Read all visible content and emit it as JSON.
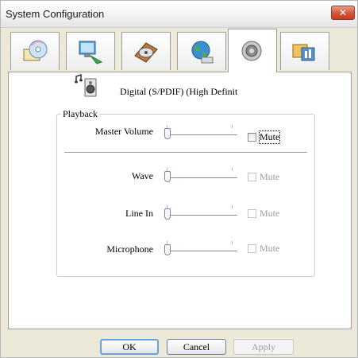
{
  "window": {
    "title": "System Configuration",
    "close_icon": "close-icon"
  },
  "tabs": [
    {
      "icon": "cd-icon",
      "selected": false
    },
    {
      "icon": "monitor-speaker-icon",
      "selected": false
    },
    {
      "icon": "hard-disk-icon",
      "selected": false
    },
    {
      "icon": "globe-icon",
      "selected": false
    },
    {
      "icon": "speaker-icon",
      "selected": true
    },
    {
      "icon": "tools-icon",
      "selected": false
    }
  ],
  "device": {
    "icon": "audio-device-icon",
    "name": "Digital (S/PDIF) (High Definit"
  },
  "playback": {
    "group_label": "Playback",
    "controls": [
      {
        "label": "Master Volume",
        "mute_label": "Mute",
        "mute_checked": false,
        "mute_enabled": true,
        "level": 0
      },
      {
        "label": "Wave",
        "mute_label": "Mute",
        "mute_checked": false,
        "mute_enabled": false,
        "level": 0
      },
      {
        "label": "Line In",
        "mute_label": "Mute",
        "mute_checked": false,
        "mute_enabled": false,
        "level": 0
      },
      {
        "label": "Microphone",
        "mute_label": "Mute",
        "mute_checked": false,
        "mute_enabled": false,
        "level": 0
      }
    ]
  },
  "buttons": {
    "ok": "OK",
    "cancel": "Cancel",
    "apply": "Apply"
  },
  "colors": {
    "close": "#d2553a",
    "default_button": "#63a5d8"
  }
}
